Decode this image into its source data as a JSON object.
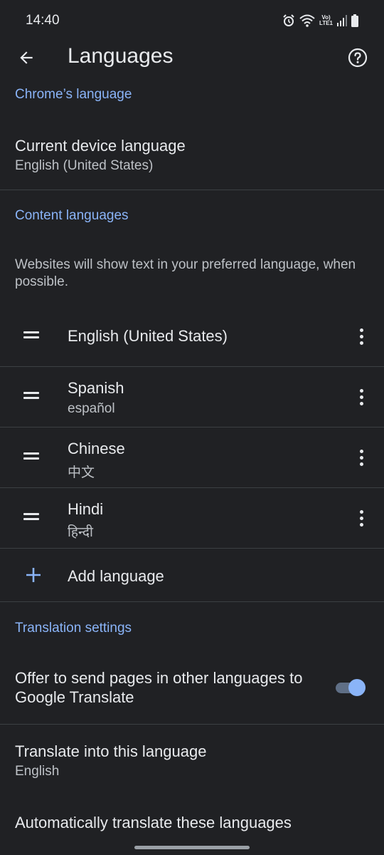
{
  "status_bar": {
    "time": "14:40",
    "network_label_top": "Vo)",
    "network_label_bottom": "LTE1"
  },
  "header": {
    "title": "Languages"
  },
  "chrome_language": {
    "section_title": "Chrome’s language",
    "current_label": "Current device language",
    "current_value": "English (United States)"
  },
  "content_languages": {
    "section_title": "Content languages",
    "description": "Websites will show text in your preferred language, when possible.",
    "languages": [
      {
        "name": "English (United States)",
        "native": ""
      },
      {
        "name": "Spanish",
        "native": "español"
      },
      {
        "name": "Chinese",
        "native": "中文"
      },
      {
        "name": "Hindi",
        "native": "हिन्दी"
      }
    ],
    "add_label": "Add language"
  },
  "translation": {
    "section_title": "Translation settings",
    "offer_label": "Offer to send pages in other languages to Google Translate",
    "offer_enabled": true,
    "target_label": "Translate into this language",
    "target_value": "English",
    "auto_label": "Automatically translate these languages"
  },
  "colors": {
    "background": "#202124",
    "accent": "#8ab4f8",
    "text": "#e8eaed",
    "secondary_text": "#bdc1c6"
  }
}
